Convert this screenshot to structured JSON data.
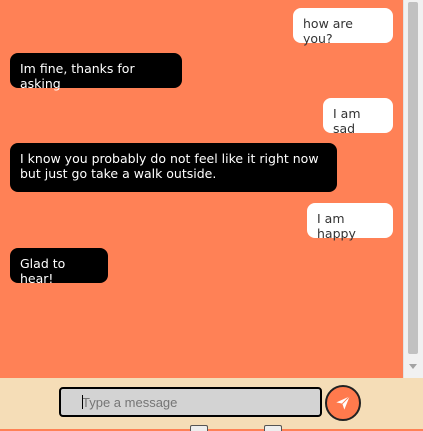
{
  "messages": [
    {
      "sender": "user",
      "text": "how are you?"
    },
    {
      "sender": "bot",
      "text": "Im fine, thanks for asking"
    },
    {
      "sender": "user",
      "text": "I am sad"
    },
    {
      "sender": "bot",
      "text": "I know you probably do not feel like it right now\nbut just go take a walk outside."
    },
    {
      "sender": "user",
      "text": "I am happy"
    },
    {
      "sender": "bot",
      "text": "Glad to hear!"
    }
  ],
  "composer": {
    "placeholder": "Type a message",
    "value": ""
  },
  "colors": {
    "chat_background": "#ff8156",
    "user_bubble": "#ffffff",
    "bot_bubble": "#000000",
    "input_bar": "#f5ddb7",
    "send_button": "#ff7a4d"
  },
  "icons": {
    "send": "paper-plane-icon"
  }
}
